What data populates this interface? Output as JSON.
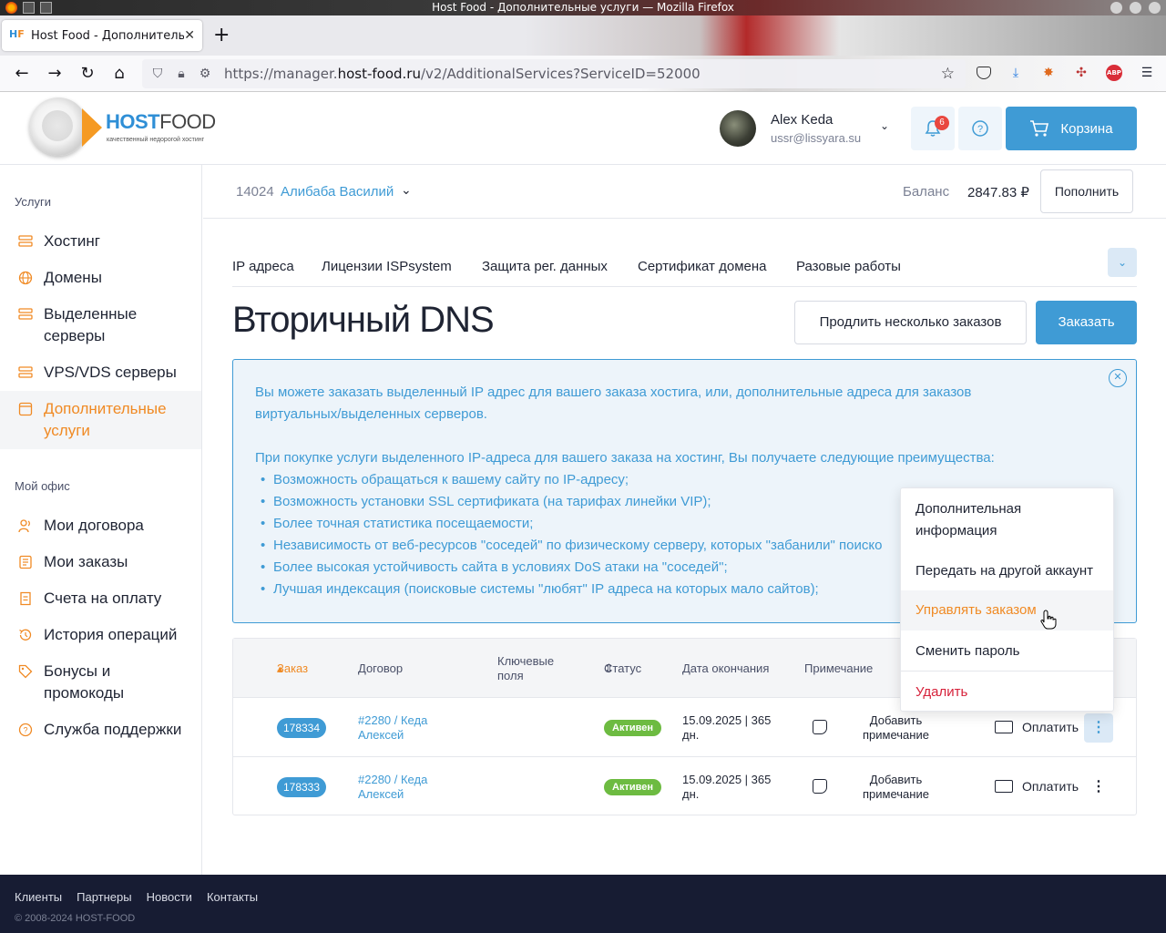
{
  "window": {
    "title": "Host Food - Дополнительные услуги — Mozilla Firefox"
  },
  "browser": {
    "tab_title": "Host Food - Дополнительные услуги",
    "url_scheme": "https://manager.",
    "url_domain": "host-food.ru",
    "url_path": "/v2/AdditionalServices?ServiceID=52000",
    "icons": [
      "back-icon",
      "forward-icon",
      "reload-icon",
      "home-icon",
      "shield-icon",
      "lock-icon",
      "bookmark-star-icon",
      "pocket-icon",
      "download-icon",
      "extension-icon",
      "extension-icon",
      "adblock-icon",
      "menu-icon"
    ]
  },
  "header": {
    "logo_host": "HOST",
    "logo_food": "FOOD",
    "logo_tagline": "качественный недорогой хостинг",
    "user_name": "Alex Keda",
    "user_email": "ussr@lissyara.su",
    "notifications_count": "6",
    "cart_label": "Корзина"
  },
  "sidebar": {
    "section_services": "Услуги",
    "items": [
      {
        "label": "Хостинг",
        "icon": "server-icon"
      },
      {
        "label": "Домены",
        "icon": "globe-icon"
      },
      {
        "label": "Выделенные серверы",
        "icon": "server-icon"
      },
      {
        "label": "VPS/VDS серверы",
        "icon": "server-icon"
      },
      {
        "label": "Дополнительные услуги",
        "icon": "cart-icon",
        "active": true
      }
    ],
    "section_office": "Мой офис",
    "office_items": [
      {
        "label": "Мои договора",
        "icon": "users-icon"
      },
      {
        "label": "Мои заказы",
        "icon": "orders-icon"
      },
      {
        "label": "Счета на оплату",
        "icon": "invoice-icon"
      },
      {
        "label": "История операций",
        "icon": "history-icon"
      },
      {
        "label": "Бонусы и промокоды",
        "icon": "tag-icon"
      },
      {
        "label": "Служба поддержки",
        "icon": "help-icon"
      }
    ]
  },
  "account": {
    "number": "14024",
    "name": "Алибаба Василий",
    "balance_label": "Баланс",
    "balance_value": "2847.83 ₽",
    "topup_label": "Пополнить"
  },
  "tabs": [
    "IP адреса",
    "Лицензии ISPsystem",
    "Защита рег. данных",
    "Сертификат домена",
    "Разовые работы"
  ],
  "page": {
    "title": "Вторичный DNS",
    "renew_label": "Продлить несколько заказов",
    "order_label": "Заказать"
  },
  "info": {
    "line1": "Вы можете заказать выделенный IP адрес для вашего заказа хостига, или, дополнительные адреса для заказов",
    "line2": "виртуальных/выделенных серверов.",
    "line3": "При покупке услуги выделенного IP-адреса для вашего заказа на хостинг, Вы получаете следующие преимущества:",
    "bullets": [
      "Возможность обращаться к вашему сайту по IP-адресу;",
      "Возможность установки SSL сертификата (на тарифах линейки VIP);",
      "Более точная статистика посещаемости;",
      "Независимость от веб-ресурсов \"соседей\" по физическому серверу, которых \"забанили\" поиско",
      "Более высокая устойчивость сайта в условиях DoS атаки на \"соседей\";",
      "Лучшая индексация (поисковые системы \"любят\" IP адреса на которых мало сайтов);"
    ]
  },
  "table": {
    "columns": [
      "Заказ",
      "Договор",
      "Ключевые поля",
      "Статус",
      "Дата окончания",
      "Примечание"
    ],
    "rows": [
      {
        "order": "178334",
        "contract": "#2280 / Кеда Алексей",
        "status": "Активен",
        "end_date": "15.09.2025 | 365 дн.",
        "note": "Добавить примечание",
        "pay": "Оплатить"
      },
      {
        "order": "178333",
        "contract": "#2280 / Кеда Алексей",
        "status": "Активен",
        "end_date": "15.09.2025 | 365 дн.",
        "note": "Добавить примечание",
        "pay": "Оплатить"
      }
    ]
  },
  "dropdown": {
    "items": [
      "Дополнительная информация",
      "Передать на другой аккаунт",
      "Управлять заказом",
      "Сменить пароль",
      "Удалить"
    ],
    "hovered": "Управлять заказом"
  },
  "footer": {
    "links": [
      "Клиенты",
      "Партнеры",
      "Новости",
      "Контакты"
    ],
    "copyright": "© 2008-2024 HOST-FOOD"
  },
  "colors": {
    "accent": "#3f9bd5",
    "brand_orange": "#f08a24",
    "status_active": "#6dbb41",
    "danger": "#d6213a",
    "footer_bg": "#171c33"
  }
}
